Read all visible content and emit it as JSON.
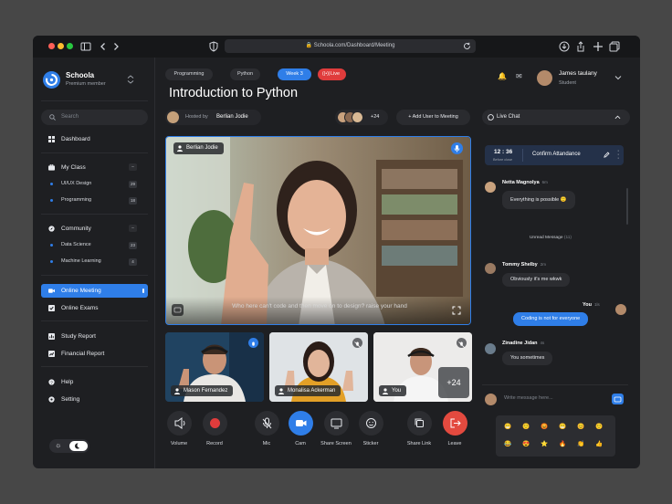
{
  "browser": {
    "url": "Schoola.com/Dashboard/Meeting"
  },
  "sidebar": {
    "brand": "Schoola",
    "brand_sub": "Premium member",
    "search_placeholder": "Search",
    "dashboard": "Dashboard",
    "my_class": "My Class",
    "my_class_items": [
      {
        "label": "UI/UX Design",
        "count": "29"
      },
      {
        "label": "Programming",
        "count": "18"
      }
    ],
    "community": "Community",
    "community_items": [
      {
        "label": "Data Science",
        "count": "23"
      },
      {
        "label": "Machine Learning",
        "count": "4"
      }
    ],
    "online_meeting": "Online Meeting",
    "online_exams": "Online Exams",
    "study_report": "Study Report",
    "financial_report": "Financial Report",
    "help": "Help",
    "setting": "Setting"
  },
  "header": {
    "tags": [
      "Programming",
      "Python"
    ],
    "week": "Week 3",
    "live": "Live",
    "user_name": "James taulany",
    "user_role": "Student"
  },
  "meeting": {
    "title": "Introduction to Python",
    "hosted_by_label": "Hosted by",
    "host_name": "Berlian Jodie",
    "extra_participants": "+24",
    "add_user": "Add User to Meeting"
  },
  "main_video": {
    "speaker": "Berlian Jodie",
    "caption": "Who here can't code and then move on to design? raise your hand"
  },
  "participants": [
    {
      "name": "Mason Fernandez"
    },
    {
      "name": "Monalisa Ackerman"
    },
    {
      "name": "You",
      "more": "+24"
    }
  ],
  "controls": [
    "Volume",
    "Record",
    "Mic",
    "Cam",
    "Share Screen",
    "Sticker",
    "Share Link",
    "Leave"
  ],
  "chat": {
    "title": "Live Chat",
    "timer": "12 : 36",
    "timer_sub": "Before close",
    "confirm": "Confirm Attandance",
    "messages": [
      {
        "name": "Netta Magnolya",
        "time": "6m",
        "text": "Everything is possible"
      },
      {
        "name": "Tommy Shelby",
        "time": "2m",
        "text": "Obviously it's me wkwk"
      },
      {
        "name": "You",
        "time": "1ls",
        "text": "Coding is not for everyone"
      },
      {
        "name": "Zinadine Jidan",
        "time": "4s",
        "text": "You sometimes"
      }
    ],
    "unread": "Unread Message",
    "unread_count": "(11)",
    "input_placeholder": "Write message here...",
    "emojis": [
      "😁",
      "🙂",
      "😡",
      "😁",
      "😊",
      "🙂",
      "😂",
      "😍",
      "⭐",
      "🔥",
      "👏",
      "👍"
    ]
  },
  "colors": {
    "accent": "#2f7ee8",
    "live": "#e03c3c",
    "leave": "#e34a3f"
  }
}
